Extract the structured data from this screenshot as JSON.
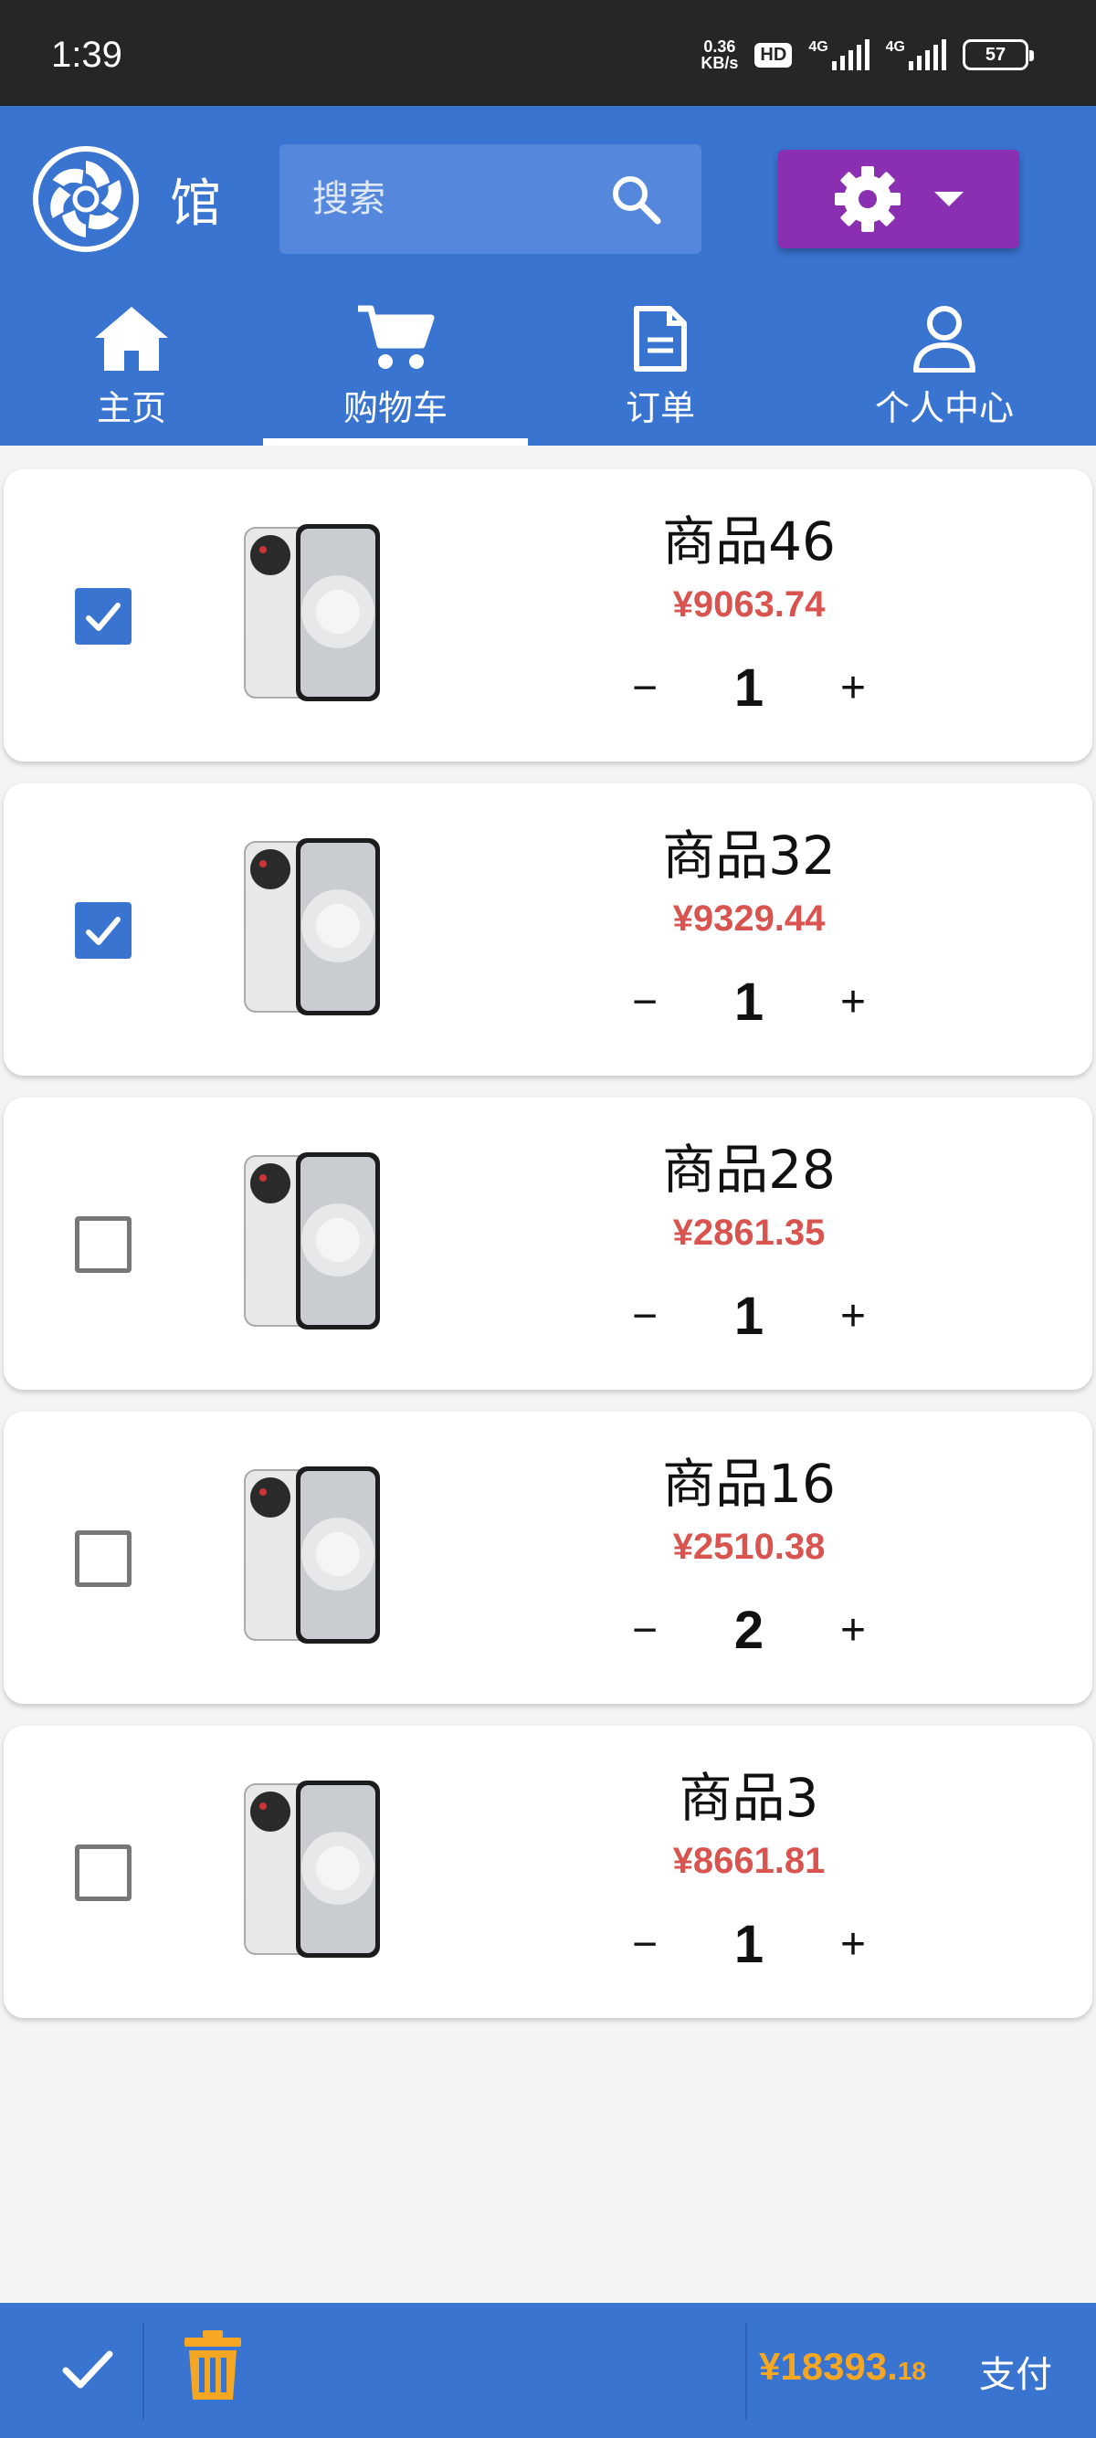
{
  "status_bar": {
    "time": "1:39",
    "net_speed_value": "0.36",
    "net_speed_unit": "KB/s",
    "hd_label": "HD",
    "network_1": "4G",
    "network_2": "4G",
    "battery": "57"
  },
  "header": {
    "app_name": "馆",
    "search": {
      "placeholder": "搜索",
      "value": ""
    },
    "colors": {
      "header_bg": "#3a74d1",
      "settings_bg": "#8a2fb2"
    }
  },
  "nav": {
    "items": [
      {
        "label": "主页",
        "icon": "home-icon",
        "active": false
      },
      {
        "label": "购物车",
        "icon": "cart-icon",
        "active": true
      },
      {
        "label": "订单",
        "icon": "document-icon",
        "active": false
      },
      {
        "label": "个人中心",
        "icon": "user-icon",
        "active": false
      }
    ]
  },
  "cart": {
    "items": [
      {
        "name": "商品46",
        "price": "¥9063.74",
        "quantity": "1",
        "checked": true
      },
      {
        "name": "商品32",
        "price": "¥9329.44",
        "quantity": "1",
        "checked": true
      },
      {
        "name": "商品28",
        "price": "¥2861.35",
        "quantity": "1",
        "checked": false
      },
      {
        "name": "商品16",
        "price": "¥2510.38",
        "quantity": "2",
        "checked": false
      },
      {
        "name": "商品3",
        "price": "¥8661.81",
        "quantity": "1",
        "checked": false
      }
    ],
    "minus_label": "−",
    "plus_label": "+"
  },
  "footer": {
    "total_main": "¥18393.",
    "total_cents": "18",
    "pay_label": "支付",
    "total_color": "#f5a623"
  }
}
